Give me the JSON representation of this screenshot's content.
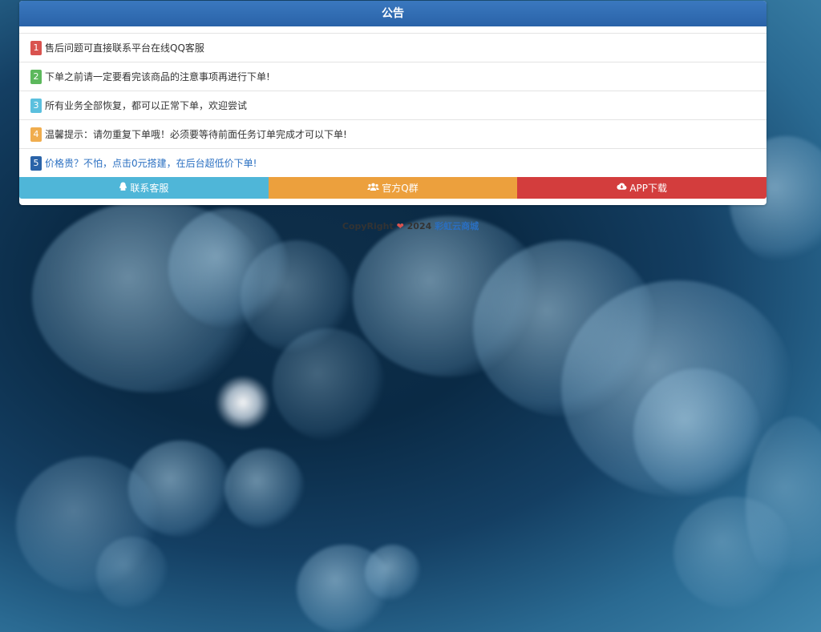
{
  "notice": {
    "title": "公告",
    "items": [
      {
        "num": "1",
        "text": "售后问题可直接联系平台在线QQ客服",
        "color": "#d9534f"
      },
      {
        "num": "2",
        "text": "下单之前请一定要看完该商品的注意事项再进行下单!",
        "color": "#5cb85c"
      },
      {
        "num": "3",
        "text": "所有业务全部恢复，都可以正常下单，欢迎尝试",
        "color": "#5bc0de"
      },
      {
        "num": "4",
        "text": "温馨提示：请勿重复下单哦！必须要等待前面任务订单完成才可以下单!",
        "color": "#f0ad4e"
      },
      {
        "num": "5",
        "text": "价格贵？不怕，点击0元搭建，在后台超低价下单!",
        "color": "#2a63a8"
      }
    ]
  },
  "buttons": {
    "contact": {
      "label": "联系客服",
      "color": "#4fb6d8",
      "icon": "qq-icon"
    },
    "group": {
      "label": "官方Q群",
      "color": "#eca03d",
      "icon": "users-icon"
    },
    "app": {
      "label": "APP下载",
      "color": "#d33d3d",
      "icon": "cloud-download-icon"
    }
  },
  "footer": {
    "copyright": "CopyRight",
    "year": "2024",
    "brand": "彩虹云商城"
  }
}
